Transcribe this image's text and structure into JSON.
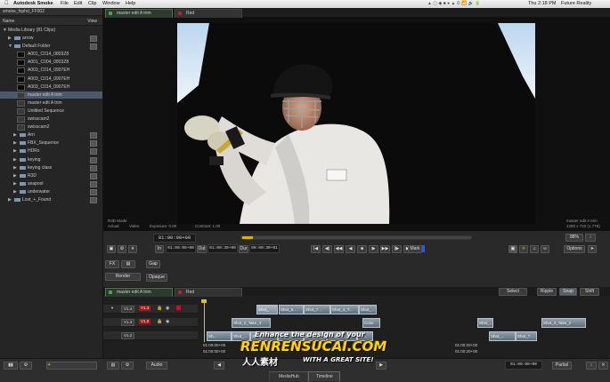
{
  "menubar": {
    "apple_icon": "apple-icon",
    "app_name": "Autodesk Smoke",
    "menus": [
      "File",
      "Edit",
      "Clip",
      "Window",
      "Help"
    ],
    "clock": "Thu 2:18 PM",
    "user": "Future Reality"
  },
  "watermark_fxphd": "fxphd",
  "library": {
    "project_title": "smoke_fxphd_FF002",
    "name_header": "Name",
    "view_header": "View",
    "media_library": "Media Library (81 Clips)",
    "items": [
      {
        "label": "arrow",
        "kind": "folder",
        "indent": 1
      },
      {
        "label": "Default Folder",
        "kind": "folder",
        "indent": 1
      },
      {
        "label": "A001_C014_0803Z8",
        "kind": "clip",
        "indent": 2
      },
      {
        "label": "A001_C004_0803Z8",
        "kind": "clip",
        "indent": 2
      },
      {
        "label": "A003_C014_0907EH",
        "kind": "clip",
        "indent": 2
      },
      {
        "label": "A003_C014_0907EH",
        "kind": "clip",
        "indent": 2
      },
      {
        "label": "A003_C014_0907EH",
        "kind": "clip",
        "indent": 2
      },
      {
        "label": "master edit A trim",
        "kind": "seq",
        "indent": 2,
        "selected": true
      },
      {
        "label": "master edit A trim",
        "kind": "seq",
        "indent": 2
      },
      {
        "label": "Untitled Sequence",
        "kind": "seq",
        "indent": 2
      },
      {
        "label": "swisscam2",
        "kind": "seq",
        "indent": 2
      },
      {
        "label": "swisscam2",
        "kind": "seq",
        "indent": 2
      },
      {
        "label": "Arri",
        "kind": "folder",
        "indent": 2
      },
      {
        "label": "FBX_Sequence",
        "kind": "folder",
        "indent": 2
      },
      {
        "label": "HDRs",
        "kind": "folder",
        "indent": 2
      },
      {
        "label": "keying",
        "kind": "folder",
        "indent": 2
      },
      {
        "label": "keying class",
        "kind": "folder",
        "indent": 2
      },
      {
        "label": "R3D",
        "kind": "folder",
        "indent": 2
      },
      {
        "label": "seapool",
        "kind": "folder",
        "indent": 2
      },
      {
        "label": "underwater",
        "kind": "folder",
        "indent": 2
      },
      {
        "label": "Lost_+_Found",
        "kind": "folder",
        "indent": 1
      }
    ]
  },
  "viewer": {
    "tab_active": "master edit A trim",
    "tab_inactive": "Red",
    "info_left": [
      "R3D Mode",
      "Actual",
      "Video",
      "Exposure: 0.00",
      "Contrast: 1.00"
    ],
    "info_right": [
      "master edit A trim",
      "1280 x 720 (1.778)"
    ],
    "timecode": "01:00:00+00",
    "zoom": "88%",
    "in_label": "In",
    "in_tc": "01:00:00+00",
    "out_label": "Out",
    "out_tc": "01:00:30+00",
    "dur_label": "Dur",
    "dur_tc": "00:00:30+01",
    "mark_label": "Mark",
    "options_label": "Options",
    "fx_label": "FX",
    "gap_label": "Gap",
    "render_label": "Render",
    "opaque_label": "Opaque",
    "photo_alt": "cricket batsman in helmet"
  },
  "timeline": {
    "tab_active": "master edit A trim",
    "tab_inactive": "Red",
    "select_label": "Select",
    "ripple_label": "Ripple",
    "snap_label": "Snap",
    "shift_label": "Shift",
    "tracks": [
      {
        "name": "V1.4",
        "badge": "V1.3"
      },
      {
        "name": "V1.3",
        "badge": "V1.2"
      },
      {
        "name": "V1.2",
        "badge": ""
      }
    ],
    "clips_row1": [
      "Shot_",
      "Shot_6...",
      "Shot_7...",
      "Shot_4_T...",
      "Shot_..."
    ],
    "clips_row2": [
      "Shot_2_Take_3",
      "Color",
      "Shot_...",
      "Shot_3_Take_2"
    ],
    "clips_row3": [
      "Sh...",
      "Shot_...",
      "Shot_...",
      "Sh...",
      "Shot_12_Ta...",
      "Shot_13...",
      "Sh...",
      "Shot_...",
      "Shot_7..."
    ],
    "tc_left_a": "01:00:00+00",
    "tc_left_b": "01:00:00+00",
    "tc_right_a": "01:00:20+00",
    "tc_right_b": "01:00:20+00",
    "audio_label": "Audio",
    "bottom_tc": "01:00:00+00",
    "partial_label": "Partial"
  },
  "bottom": {
    "tabs": [
      "MediaHub",
      "Timeline"
    ],
    "active_tab": "Timeline"
  },
  "watermark": {
    "line1": "Enhance the design of your",
    "brand": "RENRENSUCAI.COM",
    "cn": "人人素材",
    "tagline": "WITH A GREAT SITE!"
  }
}
